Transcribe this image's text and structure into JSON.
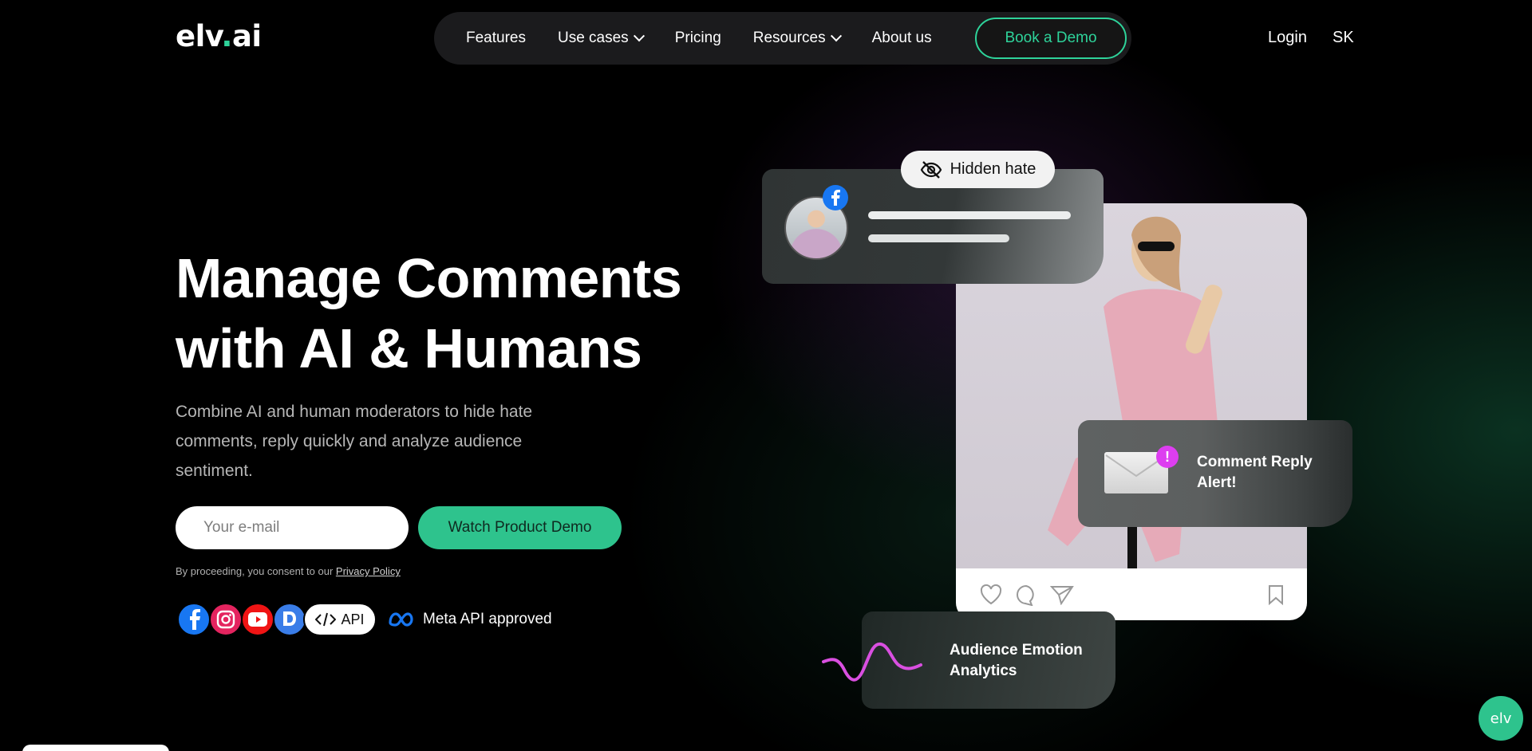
{
  "logo": {
    "text_main": "elv",
    "text_dot": ".",
    "text_end": "ai"
  },
  "nav": {
    "items": [
      {
        "label": "Features",
        "dropdown": false
      },
      {
        "label": "Use cases",
        "dropdown": true
      },
      {
        "label": "Pricing",
        "dropdown": false
      },
      {
        "label": "Resources",
        "dropdown": true
      },
      {
        "label": "About us",
        "dropdown": false
      }
    ],
    "book_demo": "Book a Demo",
    "login": "Login",
    "language": "SK"
  },
  "hero": {
    "title_line1": "Manage Comments",
    "title_line2": "with AI & Humans",
    "subtitle": "Combine AI and human moderators to hide hate comments, reply quickly and analyze audience sentiment.",
    "email_placeholder": "Your e-mail",
    "cta": "Watch Product Demo",
    "consent_prefix": "By proceeding, you consent to our ",
    "consent_link": "Privacy Policy",
    "api_label": "API",
    "meta_label": "Meta API approved"
  },
  "cards": {
    "hidden_hate": "Hidden hate",
    "comment_reply": "Comment Reply Alert!",
    "alert_mark": "!",
    "emotion": "Audience Emotion Analytics"
  },
  "chat_button": "elv",
  "colors": {
    "accent": "#2ed39a",
    "cta": "#2ec38d",
    "alert": "#dd3ef0",
    "wave": "#d94fe0"
  }
}
